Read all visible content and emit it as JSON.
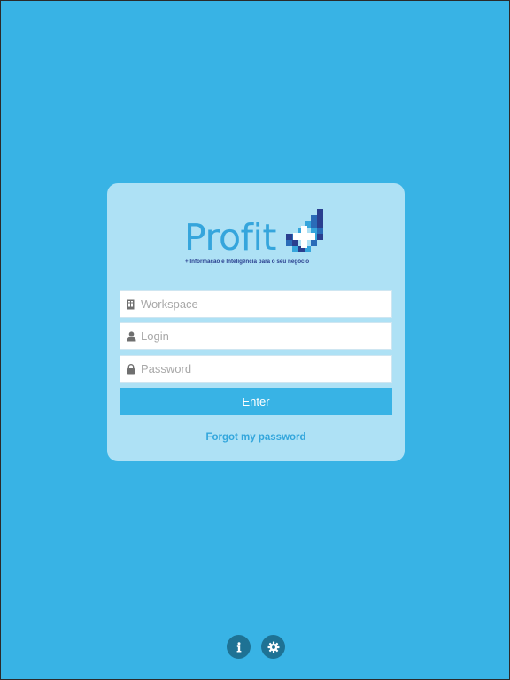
{
  "theme": {
    "background": "#38b3e5",
    "card": "#aee1f5",
    "accent": "#38b3e5",
    "link": "#33a6dc",
    "logo_blue": "#35a5dc",
    "logo_navy": "#2a3f8f",
    "icon_button": "#1e7294"
  },
  "logo": {
    "name": "Profit",
    "tagline": "+ Informação e Inteligência para o seu negócio",
    "icon": "pixel-cross-icon"
  },
  "form": {
    "workspace": {
      "placeholder": "Workspace",
      "value": "",
      "icon": "building-icon"
    },
    "login": {
      "placeholder": "Login",
      "value": "",
      "icon": "user-icon"
    },
    "password": {
      "placeholder": "Password",
      "value": "",
      "icon": "lock-icon"
    },
    "enter_label": "Enter",
    "forgot_label": "Forgot my password"
  },
  "bottom_bar": {
    "info_icon": "info-icon",
    "settings_icon": "gear-icon"
  }
}
